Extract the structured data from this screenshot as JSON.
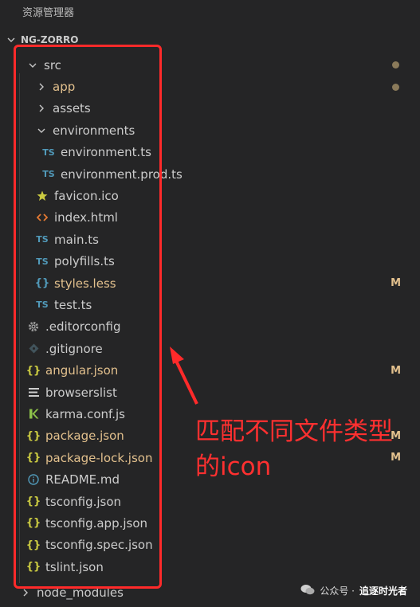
{
  "panel": {
    "title": "资源管理器"
  },
  "project": {
    "name": "NG-ZORRO"
  },
  "colors": {
    "ts": "#519aba",
    "json": "#cbcb41",
    "html": "#e37933",
    "modified": "#e2c08d",
    "annotation": "#ff2a2a"
  },
  "tree": [
    {
      "label": "src",
      "chevron": "down",
      "indent": 1,
      "icon": "",
      "modified": false,
      "badge": "",
      "dot": true
    },
    {
      "label": "app",
      "chevron": "right",
      "indent": 2,
      "icon": "",
      "modified": true,
      "badge": "",
      "dot": true
    },
    {
      "label": "assets",
      "chevron": "right",
      "indent": 2,
      "icon": "",
      "modified": false,
      "badge": "",
      "dot": false
    },
    {
      "label": "environments",
      "chevron": "down",
      "indent": 2,
      "icon": "",
      "modified": false,
      "badge": "",
      "dot": false
    },
    {
      "label": "environment.ts",
      "chevron": "",
      "indent": 3,
      "icon": "ts",
      "modified": false,
      "badge": "",
      "dot": false
    },
    {
      "label": "environment.prod.ts",
      "chevron": "",
      "indent": 3,
      "icon": "ts",
      "modified": false,
      "badge": "",
      "dot": false
    },
    {
      "label": "favicon.ico",
      "chevron": "",
      "indent": 2,
      "icon": "star",
      "modified": false,
      "badge": "",
      "dot": false
    },
    {
      "label": "index.html",
      "chevron": "",
      "indent": 2,
      "icon": "html",
      "modified": false,
      "badge": "",
      "dot": false
    },
    {
      "label": "main.ts",
      "chevron": "",
      "indent": 2,
      "icon": "ts",
      "modified": false,
      "badge": "",
      "dot": false
    },
    {
      "label": "polyfills.ts",
      "chevron": "",
      "indent": 2,
      "icon": "ts",
      "modified": false,
      "badge": "",
      "dot": false
    },
    {
      "label": "styles.less",
      "chevron": "",
      "indent": 2,
      "icon": "less",
      "modified": true,
      "badge": "M",
      "dot": false
    },
    {
      "label": "test.ts",
      "chevron": "",
      "indent": 2,
      "icon": "ts",
      "modified": false,
      "badge": "",
      "dot": false
    },
    {
      "label": ".editorconfig",
      "chevron": "",
      "indent": 1,
      "icon": "gear",
      "modified": false,
      "badge": "",
      "dot": false
    },
    {
      "label": ".gitignore",
      "chevron": "",
      "indent": 1,
      "icon": "git",
      "modified": false,
      "badge": "",
      "dot": false
    },
    {
      "label": "angular.json",
      "chevron": "",
      "indent": 1,
      "icon": "json",
      "modified": true,
      "badge": "M",
      "dot": false
    },
    {
      "label": "browserslist",
      "chevron": "",
      "indent": 1,
      "icon": "lines",
      "modified": false,
      "badge": "",
      "dot": false
    },
    {
      "label": "karma.conf.js",
      "chevron": "",
      "indent": 1,
      "icon": "karma",
      "modified": false,
      "badge": "",
      "dot": false
    },
    {
      "label": "package.json",
      "chevron": "",
      "indent": 1,
      "icon": "json",
      "modified": true,
      "badge": "M",
      "dot": false
    },
    {
      "label": "package-lock.json",
      "chevron": "",
      "indent": 1,
      "icon": "json",
      "modified": true,
      "badge": "M",
      "dot": false
    },
    {
      "label": "README.md",
      "chevron": "",
      "indent": 1,
      "icon": "info",
      "modified": false,
      "badge": "",
      "dot": false
    },
    {
      "label": "tsconfig.json",
      "chevron": "",
      "indent": 1,
      "icon": "json",
      "modified": false,
      "badge": "",
      "dot": false
    },
    {
      "label": "tsconfig.app.json",
      "chevron": "",
      "indent": 1,
      "icon": "json",
      "modified": false,
      "badge": "",
      "dot": false
    },
    {
      "label": "tsconfig.spec.json",
      "chevron": "",
      "indent": 1,
      "icon": "json",
      "modified": false,
      "badge": "",
      "dot": false
    },
    {
      "label": "tslint.json",
      "chevron": "",
      "indent": 1,
      "icon": "json",
      "modified": false,
      "badge": "",
      "dot": false
    }
  ],
  "node_modules": {
    "label": "node_modules"
  },
  "annotation": {
    "text": "匹配不同文件类型的icon"
  },
  "watermark": {
    "prefix": "公众号 · ",
    "name": "追逐时光者"
  }
}
